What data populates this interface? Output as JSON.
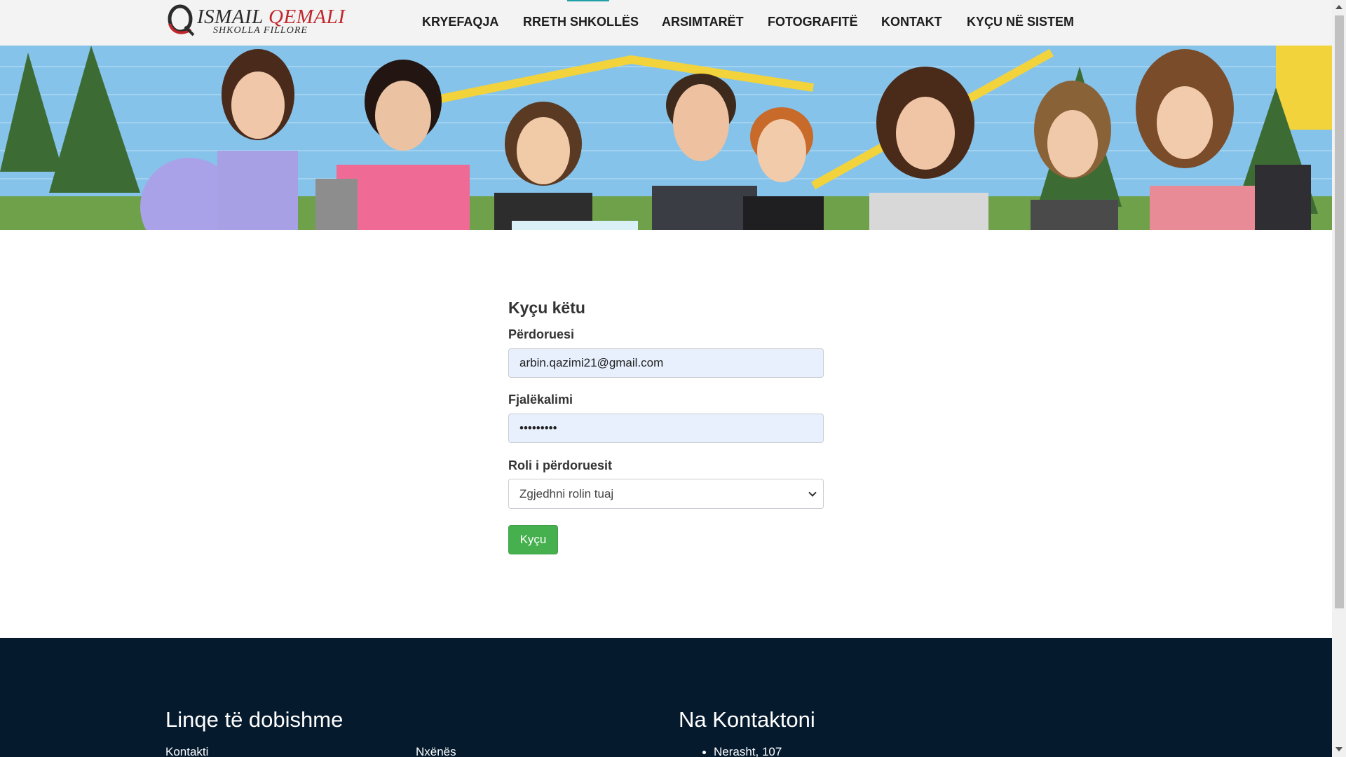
{
  "header": {
    "logo": {
      "first": "ISMAIL",
      "last": "QEMALI",
      "subtitle": "SHKOLLA FILLORE"
    },
    "nav": [
      {
        "label": "KRYEFAQJA"
      },
      {
        "label": "RRETH SHKOLLËS"
      },
      {
        "label": "ARSIMTARËT"
      },
      {
        "label": "FOTOGRAFITË"
      },
      {
        "label": "KONTAKT"
      },
      {
        "label": "KYÇU NË SISTEM"
      }
    ]
  },
  "form": {
    "title": "Kyçu këtu",
    "username": {
      "label": "Përdoruesi",
      "value": "arbin.qazimi21@gmail.com"
    },
    "password": {
      "label": "Fjalëkalimi",
      "value": "•••••••••"
    },
    "role": {
      "label": "Roli i përdoruesit",
      "selected": "Zgjedhni rolin tuaj"
    },
    "submit": "Kyçu"
  },
  "footer": {
    "links_heading": "Linqe të dobishme",
    "links": [
      "Kontakti",
      "Nxënës"
    ],
    "contact_heading": "Na Kontaktoni",
    "contact_items": [
      "Nerasht, 107"
    ]
  },
  "colors": {
    "accent_green": "#46b04e",
    "footer_bg": "#061a2e",
    "logo_red": "#c0262c",
    "nav_indicator": "#1fa0a4",
    "input_autofill": "#e8f0fe"
  }
}
